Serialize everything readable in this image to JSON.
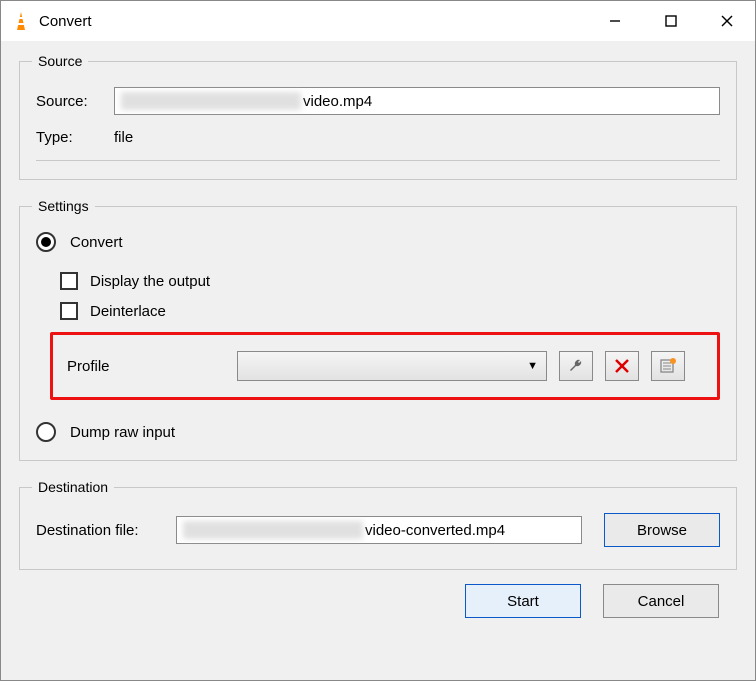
{
  "window": {
    "title": "Convert"
  },
  "source": {
    "legend": "Source",
    "source_label": "Source:",
    "source_value": "video.mp4",
    "type_label": "Type:",
    "type_value": "file"
  },
  "settings": {
    "legend": "Settings",
    "convert_label": "Convert",
    "display_output_label": "Display the output",
    "deinterlace_label": "Deinterlace",
    "profile_label": "Profile",
    "profile_value": "",
    "dump_label": "Dump raw input"
  },
  "destination": {
    "legend": "Destination",
    "dest_label": "Destination file:",
    "dest_value": "video-converted.mp4",
    "browse_label": "Browse"
  },
  "buttons": {
    "start": "Start",
    "cancel": "Cancel"
  }
}
